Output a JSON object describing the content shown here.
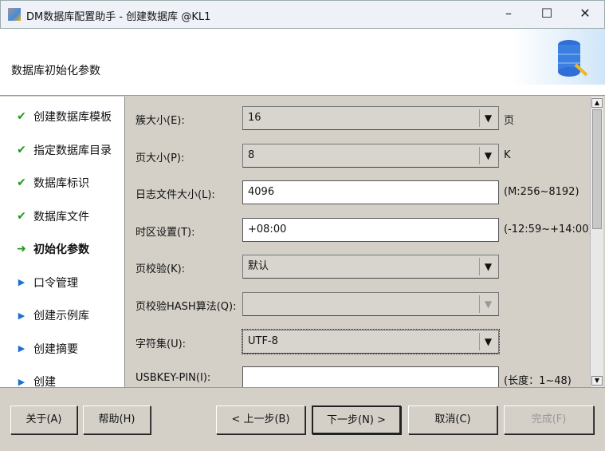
{
  "window": {
    "title": "DM数据库配置助手 - 创建数据库 @KL1",
    "minimize": "–",
    "maximize": "☐",
    "close": "✕"
  },
  "header": {
    "title": "数据库初始化参数"
  },
  "sidebar": {
    "items": [
      {
        "label": "创建数据库模板",
        "state": "done",
        "icon": "✔"
      },
      {
        "label": "指定数据库目录",
        "state": "done",
        "icon": "✔"
      },
      {
        "label": "数据库标识",
        "state": "done",
        "icon": "✔"
      },
      {
        "label": "数据库文件",
        "state": "done",
        "icon": "✔"
      },
      {
        "label": "初始化参数",
        "state": "current",
        "icon": "➜"
      },
      {
        "label": "口令管理",
        "state": "pending",
        "icon": "▶"
      },
      {
        "label": "创建示例库",
        "state": "pending",
        "icon": "▶"
      },
      {
        "label": "创建摘要",
        "state": "pending",
        "icon": "▶"
      },
      {
        "label": "创建",
        "state": "pending",
        "icon": "▶"
      }
    ]
  },
  "form": {
    "fields": [
      {
        "label": "簇大小(E):",
        "value": "16",
        "type": "select",
        "unit": "页"
      },
      {
        "label": "页大小(P):",
        "value": "8",
        "type": "select",
        "unit": "K"
      },
      {
        "label": "日志文件大小(L):",
        "value": "4096",
        "type": "input",
        "unit": "(M:256~8192)"
      },
      {
        "label": "时区设置(T):",
        "value": "+08:00",
        "type": "input",
        "unit": "(-12:59~+14:00)"
      },
      {
        "label": "页校验(K):",
        "value": "默认",
        "type": "select",
        "unit": ""
      },
      {
        "label": "页校验HASH算法(Q):",
        "value": "",
        "type": "select-disabled",
        "unit": ""
      },
      {
        "label": "字符集(U):",
        "value": "UTF-8",
        "type": "select",
        "unit": ""
      },
      {
        "label": "USBKEY-PIN(I):",
        "value": "",
        "type": "input",
        "unit": "(长度：1~48)"
      }
    ]
  },
  "buttons": {
    "about": "关于(A)",
    "help": "帮助(H)",
    "prev": "< 上一步(B)",
    "next": "下一步(N) >",
    "cancel": "取消(C)",
    "finish": "完成(F)"
  },
  "colors": {
    "done": "#1a9a1a",
    "pending": "#1e6fd0"
  }
}
